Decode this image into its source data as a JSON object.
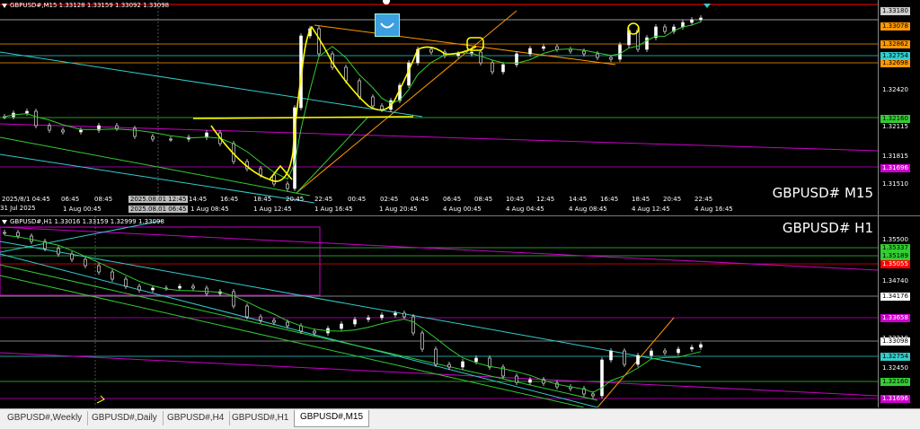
{
  "m15": {
    "header": "GBPUSD#,M15  1.33128 1.33159 1.33092 1.33098",
    "symbol": "GBPUSD# M15",
    "price_labels": [
      {
        "text": "1.33180",
        "color": "#000000",
        "bg": "#d0d0d0"
      },
      {
        "text": "1.33078",
        "color": "#000000",
        "bg": "#ff9900"
      },
      {
        "text": "1.32862",
        "color": "#000000",
        "bg": "#ff9900"
      },
      {
        "text": "1.32754",
        "color": "#000000",
        "bg": "#33cccc"
      },
      {
        "text": "1.32698",
        "color": "#000000",
        "bg": "#ff9900"
      },
      {
        "text": "1.32420",
        "color": "#ffffff",
        "bg": "#000000"
      },
      {
        "text": "1.32160",
        "color": "#000000",
        "bg": "#33cc33"
      },
      {
        "text": "1.32115",
        "color": "#ffffff",
        "bg": "#000000"
      },
      {
        "text": "1.31815",
        "color": "#ffffff",
        "bg": "#000000"
      },
      {
        "text": "1.31696",
        "color": "#ffffff",
        "bg": "#cc00cc"
      },
      {
        "text": "1.31510",
        "color": "#ffffff",
        "bg": "#000000"
      }
    ],
    "time_labels": [
      "31 Jul 2025",
      "2025/8/1 04:45",
      "06:45",
      "08:45",
      "2025.08.01 12:45",
      "14:45",
      "16:45",
      "18:45",
      "20:45",
      "22:45",
      "00:45",
      "02:45",
      "04:45",
      "06:45",
      "08:45",
      "10:45",
      "12:45",
      "14:45",
      "16:45",
      "18:45",
      "20:45",
      "22:45"
    ],
    "time_labels_row2": [
      "1 Aug 00:45",
      "2025.08.01 06:45",
      "1 Aug 08:45",
      "1 Aug 12:45",
      "1 Aug 16:45",
      "1 Aug 20:45",
      "4 Aug 00:45",
      "4 Aug 04:45",
      "4 Aug 08:45",
      "4 Aug 12:45",
      "4 Aug 16:45"
    ]
  },
  "h1": {
    "header": "GBPUSD#,H1  1.33016 1.33159 1.32999 1.33098",
    "symbol": "GBPUSD# H1",
    "price_labels": [
      {
        "text": "1.35500",
        "color": "#ffffff",
        "bg": "#000000"
      },
      {
        "text": "1.35337",
        "color": "#000000",
        "bg": "#33cc33"
      },
      {
        "text": "1.35189",
        "color": "#000000",
        "bg": "#33cc33"
      },
      {
        "text": "1.35055",
        "color": "#ffffff",
        "bg": "#ff0000"
      },
      {
        "text": "1.34740",
        "color": "#ffffff",
        "bg": "#000000"
      },
      {
        "text": "1.34176",
        "color": "#000000",
        "bg": "#ffffff"
      },
      {
        "text": "1.33658",
        "color": "#ffffff",
        "bg": "#cc00cc"
      },
      {
        "text": "1.33210",
        "color": "#ffffff",
        "bg": "#000000"
      },
      {
        "text": "1.33098",
        "color": "#000000",
        "bg": "#ffffff"
      },
      {
        "text": "1.32754",
        "color": "#000000",
        "bg": "#33cccc"
      },
      {
        "text": "1.32450",
        "color": "#ffffff",
        "bg": "#000000"
      },
      {
        "text": "1.32160",
        "color": "#000000",
        "bg": "#33cc33"
      },
      {
        "text": "1.31696",
        "color": "#ffffff",
        "bg": "#cc00cc"
      }
    ]
  },
  "tabs": [
    "GBPUSD#,Weekly",
    "GBPUSD#,Daily",
    "GBPUSD#,H4",
    "GBPUSD#,H1",
    "GBPUSD#,M15"
  ],
  "active_tab": "GBPUSD#,M15",
  "colors": {
    "up": "#ffffff",
    "down": "#ffffff",
    "trend_orange": "#ff9900",
    "trend_cyan": "#33cccc",
    "trend_magenta": "#cc00cc",
    "trend_green": "#33cc33",
    "drawing_yellow": "#ffff00"
  }
}
